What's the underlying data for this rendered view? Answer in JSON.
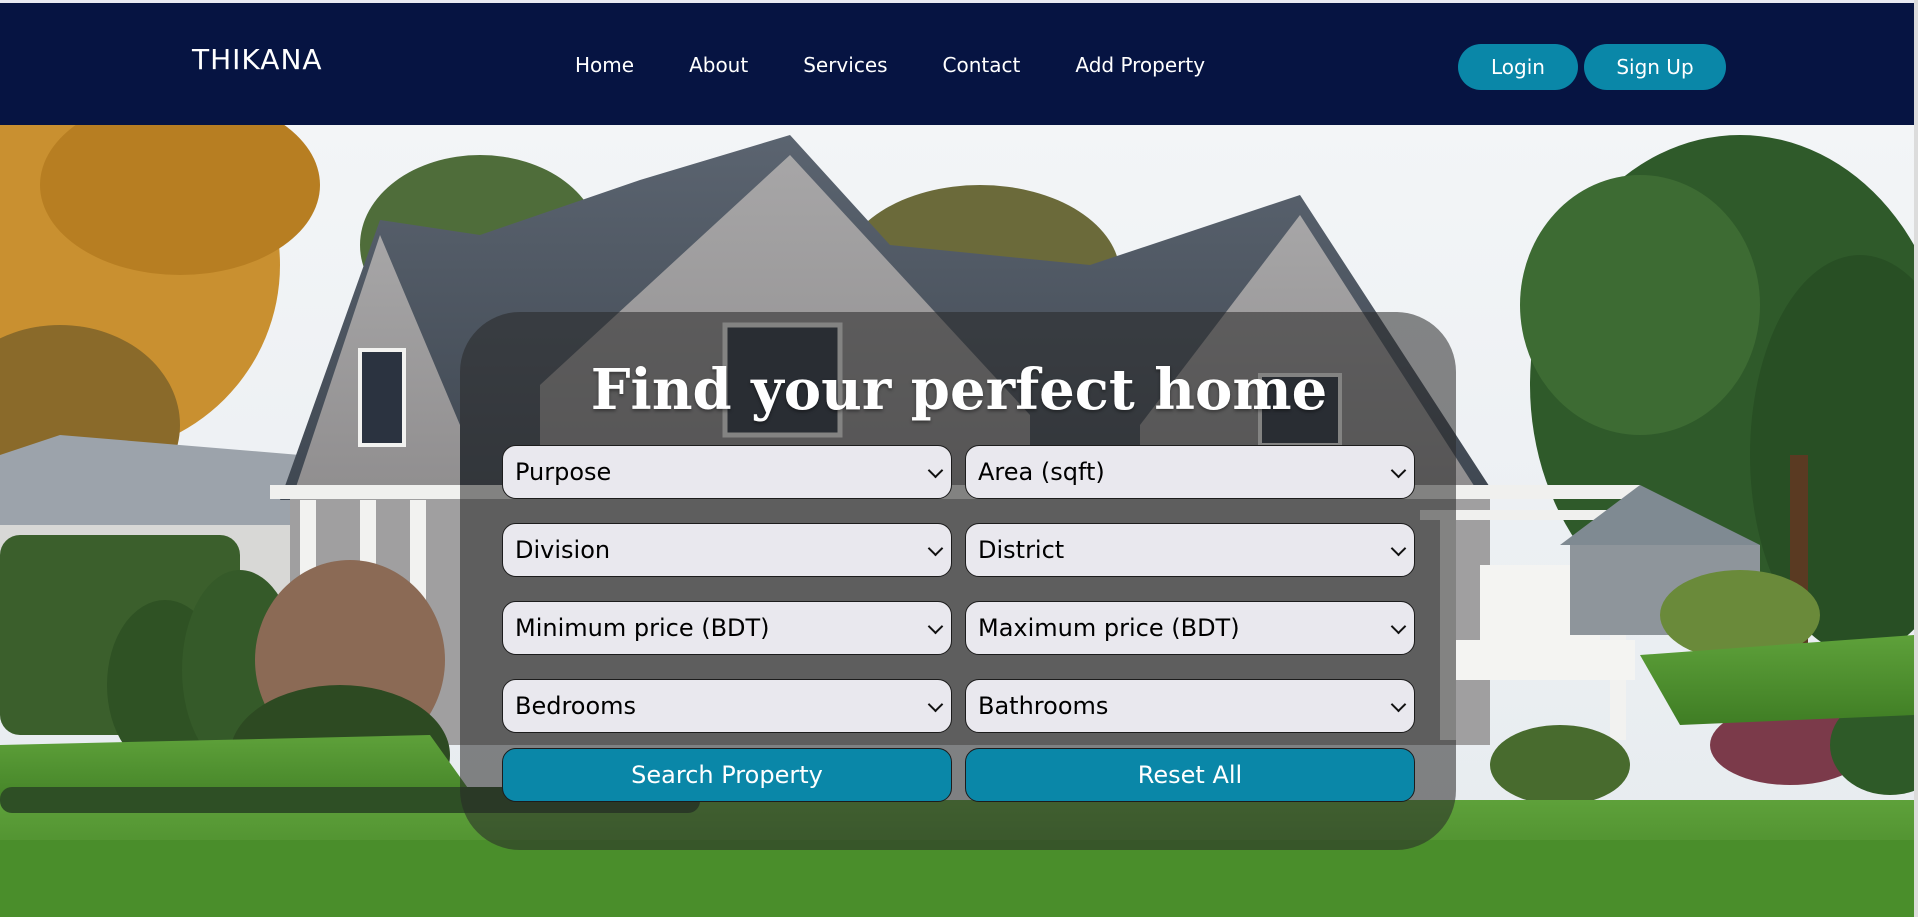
{
  "header": {
    "brand": "THIKANA",
    "nav": [
      {
        "label": "Home"
      },
      {
        "label": "About"
      },
      {
        "label": "Services"
      },
      {
        "label": "Contact"
      },
      {
        "label": "Add Property"
      }
    ],
    "login_label": "Login",
    "signup_label": "Sign Up"
  },
  "search": {
    "title": "Find your perfect home",
    "fields": {
      "purpose": "Purpose",
      "area": "Area (sqft)",
      "division": "Division",
      "district": "District",
      "min_price": "Minimum price (BDT)",
      "max_price": "Maximum price (BDT)",
      "bedrooms": "Bedrooms",
      "bathrooms": "Bathrooms"
    },
    "search_label": "Search Property",
    "reset_label": "Reset All"
  },
  "colors": {
    "navbar": "#061442",
    "accent": "#0a87a8",
    "select_bg": "#e9e8ee"
  },
  "icons": {
    "select_arrow": "chevron-down-icon"
  }
}
